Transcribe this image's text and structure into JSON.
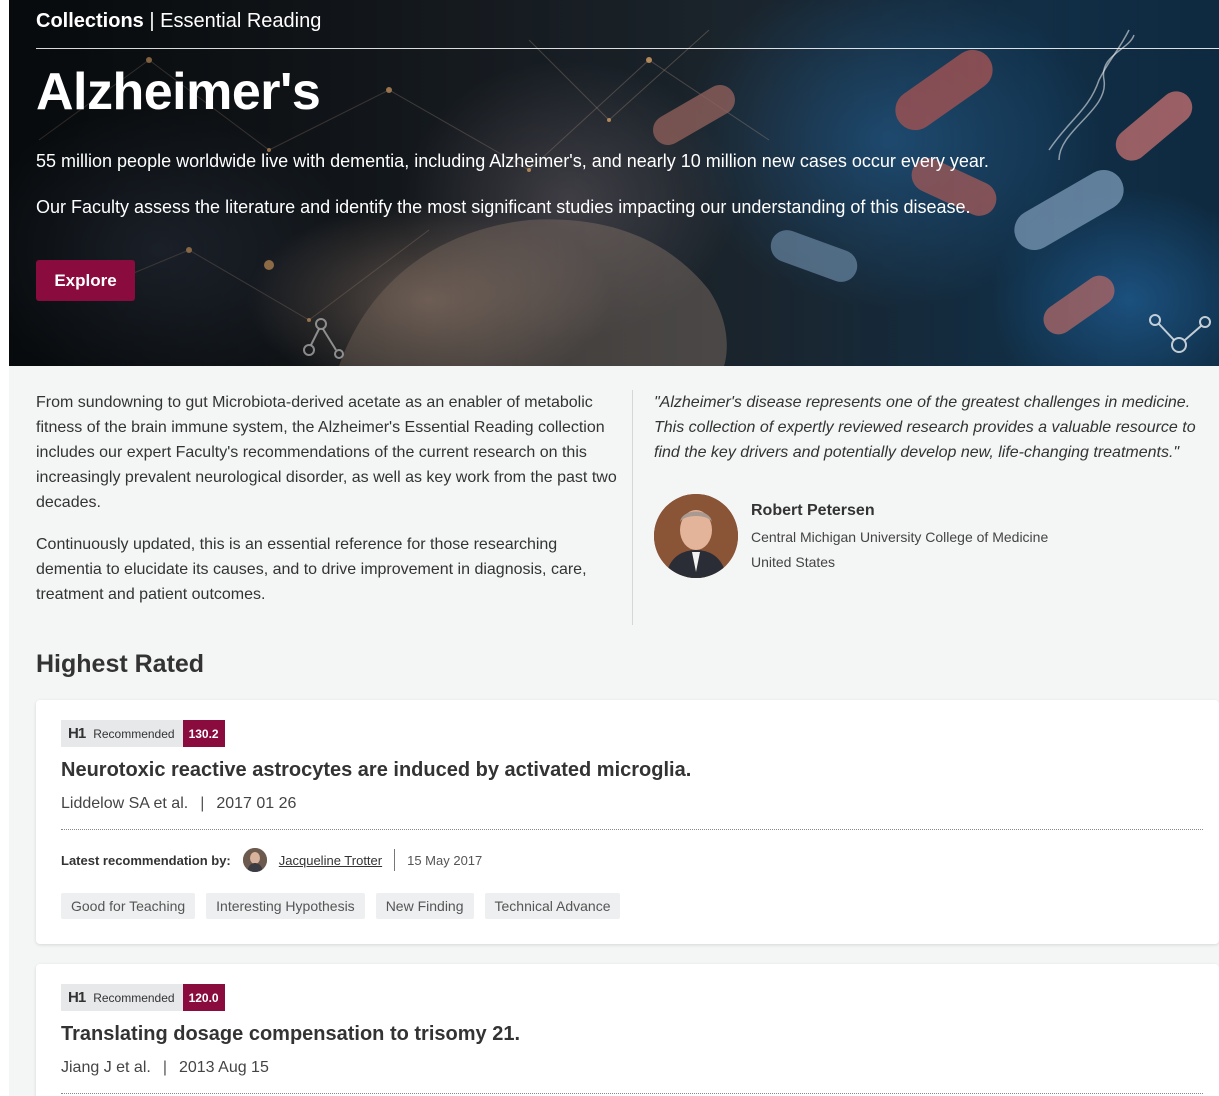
{
  "hero": {
    "breadcrumb_strong": "Collections",
    "breadcrumb_sep": " | ",
    "breadcrumb_rest": "Essential Reading",
    "title": "Alzheimer's",
    "para1": "55 million people worldwide live with dementia, including Alzheimer's, and nearly 10 million new cases occur every year.",
    "para2": "Our Faculty assess the literature and identify the most significant studies impacting our understanding of this disease.",
    "explore_label": "Explore"
  },
  "intro": {
    "para1": "From sundowning to gut Microbiota-derived acetate as an enabler of metabolic fitness of the brain immune system, the Alzheimer's Essential Reading collection includes our expert Faculty's recommendations of the current research on this increasingly prevalent neurological disorder, as well as key work from the past two decades.",
    "para2": "Continuously updated, this is an essential reference for those researching dementia to elucidate its causes, and to drive improvement in diagnosis, care, treatment and patient outcomes.",
    "quote": "\"Alzheimer's disease represents one of the greatest challenges in medicine. This collection of expertly reviewed research provides a valuable resource to find the key drivers and potentially develop new, life-changing treatments.\"",
    "person": {
      "name": "Robert Petersen",
      "institution": "Central Michigan University College of Medicine",
      "country": "United States"
    }
  },
  "section_title": "Highest Rated",
  "articles": [
    {
      "badge_logo": "H1",
      "badge_label": "Recommended",
      "score": "130.2",
      "title": "Neurotoxic reactive astrocytes are induced by activated microglia.",
      "authors": "Liddelow SA et al.",
      "date": "2017 01 26",
      "latest_label": "Latest recommendation by:",
      "recommender": "Jacqueline Trotter",
      "recommend_date": "15 May 2017",
      "tags": [
        "Good for Teaching",
        "Interesting Hypothesis",
        "New Finding",
        "Technical Advance"
      ]
    },
    {
      "badge_logo": "H1",
      "badge_label": "Recommended",
      "score": "120.0",
      "title": "Translating dosage compensation to trisomy 21.",
      "authors": "Jiang J et al.",
      "date": "2013 Aug 15"
    }
  ],
  "colors": {
    "accent": "#8a0c3e",
    "tag_bg": "#eeeff0",
    "page_bg": "#f4f5f5"
  }
}
